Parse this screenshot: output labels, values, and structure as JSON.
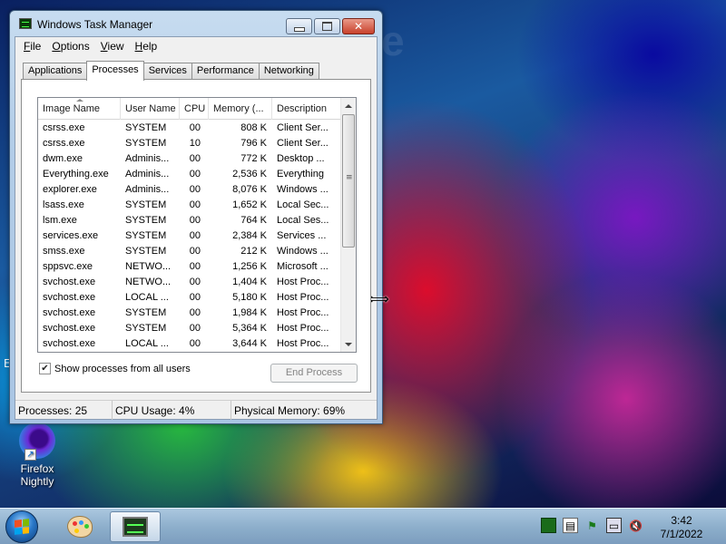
{
  "desktop": {
    "watermark": "e",
    "edge_letter": "E",
    "icons": [
      {
        "label_line1": "Firefox",
        "label_line2": "Nightly"
      }
    ]
  },
  "window": {
    "title": "Windows Task Manager",
    "close_glyph": "✕"
  },
  "menu": [
    "File",
    "Options",
    "View",
    "Help"
  ],
  "tabs": [
    {
      "label": "Applications",
      "active": false
    },
    {
      "label": "Processes",
      "active": true
    },
    {
      "label": "Services",
      "active": false
    },
    {
      "label": "Performance",
      "active": false
    },
    {
      "label": "Networking",
      "active": false
    }
  ],
  "columns": [
    "Image Name",
    "User Name",
    "CPU",
    "Memory (...",
    "Description"
  ],
  "processes": [
    {
      "name": "csrss.exe",
      "user": "SYSTEM",
      "cpu": "00",
      "mem": "808 K",
      "desc": "Client Ser..."
    },
    {
      "name": "csrss.exe",
      "user": "SYSTEM",
      "cpu": "10",
      "mem": "796 K",
      "desc": "Client Ser..."
    },
    {
      "name": "dwm.exe",
      "user": "Adminis...",
      "cpu": "00",
      "mem": "772 K",
      "desc": "Desktop ..."
    },
    {
      "name": "Everything.exe",
      "user": "Adminis...",
      "cpu": "00",
      "mem": "2,536 K",
      "desc": "Everything"
    },
    {
      "name": "explorer.exe",
      "user": "Adminis...",
      "cpu": "00",
      "mem": "8,076 K",
      "desc": "Windows ..."
    },
    {
      "name": "lsass.exe",
      "user": "SYSTEM",
      "cpu": "00",
      "mem": "1,652 K",
      "desc": "Local Sec..."
    },
    {
      "name": "lsm.exe",
      "user": "SYSTEM",
      "cpu": "00",
      "mem": "764 K",
      "desc": "Local Ses..."
    },
    {
      "name": "services.exe",
      "user": "SYSTEM",
      "cpu": "00",
      "mem": "2,384 K",
      "desc": "Services ..."
    },
    {
      "name": "smss.exe",
      "user": "SYSTEM",
      "cpu": "00",
      "mem": "212 K",
      "desc": "Windows ..."
    },
    {
      "name": "sppsvc.exe",
      "user": "NETWO...",
      "cpu": "00",
      "mem": "1,256 K",
      "desc": "Microsoft ..."
    },
    {
      "name": "svchost.exe",
      "user": "NETWO...",
      "cpu": "00",
      "mem": "1,404 K",
      "desc": "Host Proc..."
    },
    {
      "name": "svchost.exe",
      "user": "LOCAL ...",
      "cpu": "00",
      "mem": "5,180 K",
      "desc": "Host Proc..."
    },
    {
      "name": "svchost.exe",
      "user": "SYSTEM",
      "cpu": "00",
      "mem": "1,984 K",
      "desc": "Host Proc..."
    },
    {
      "name": "svchost.exe",
      "user": "SYSTEM",
      "cpu": "00",
      "mem": "5,364 K",
      "desc": "Host Proc..."
    },
    {
      "name": "svchost.exe",
      "user": "LOCAL ...",
      "cpu": "00",
      "mem": "3,644 K",
      "desc": "Host Proc..."
    }
  ],
  "show_all": {
    "label": "Show processes from all users",
    "checked": true,
    "check_glyph": "✔"
  },
  "end_process_label": "End Process",
  "status": {
    "processes": "Processes: 25",
    "cpu": "CPU Usage: 4%",
    "memory": "Physical Memory: 69%"
  },
  "cursor_glyph": "⟺",
  "taskbar": {
    "tray_glyphs": {
      "doc": "▤",
      "flag": "⚑",
      "net": "▭",
      "vol": "🔇"
    },
    "clock_time": "3:42",
    "clock_date": "7/1/2022"
  }
}
